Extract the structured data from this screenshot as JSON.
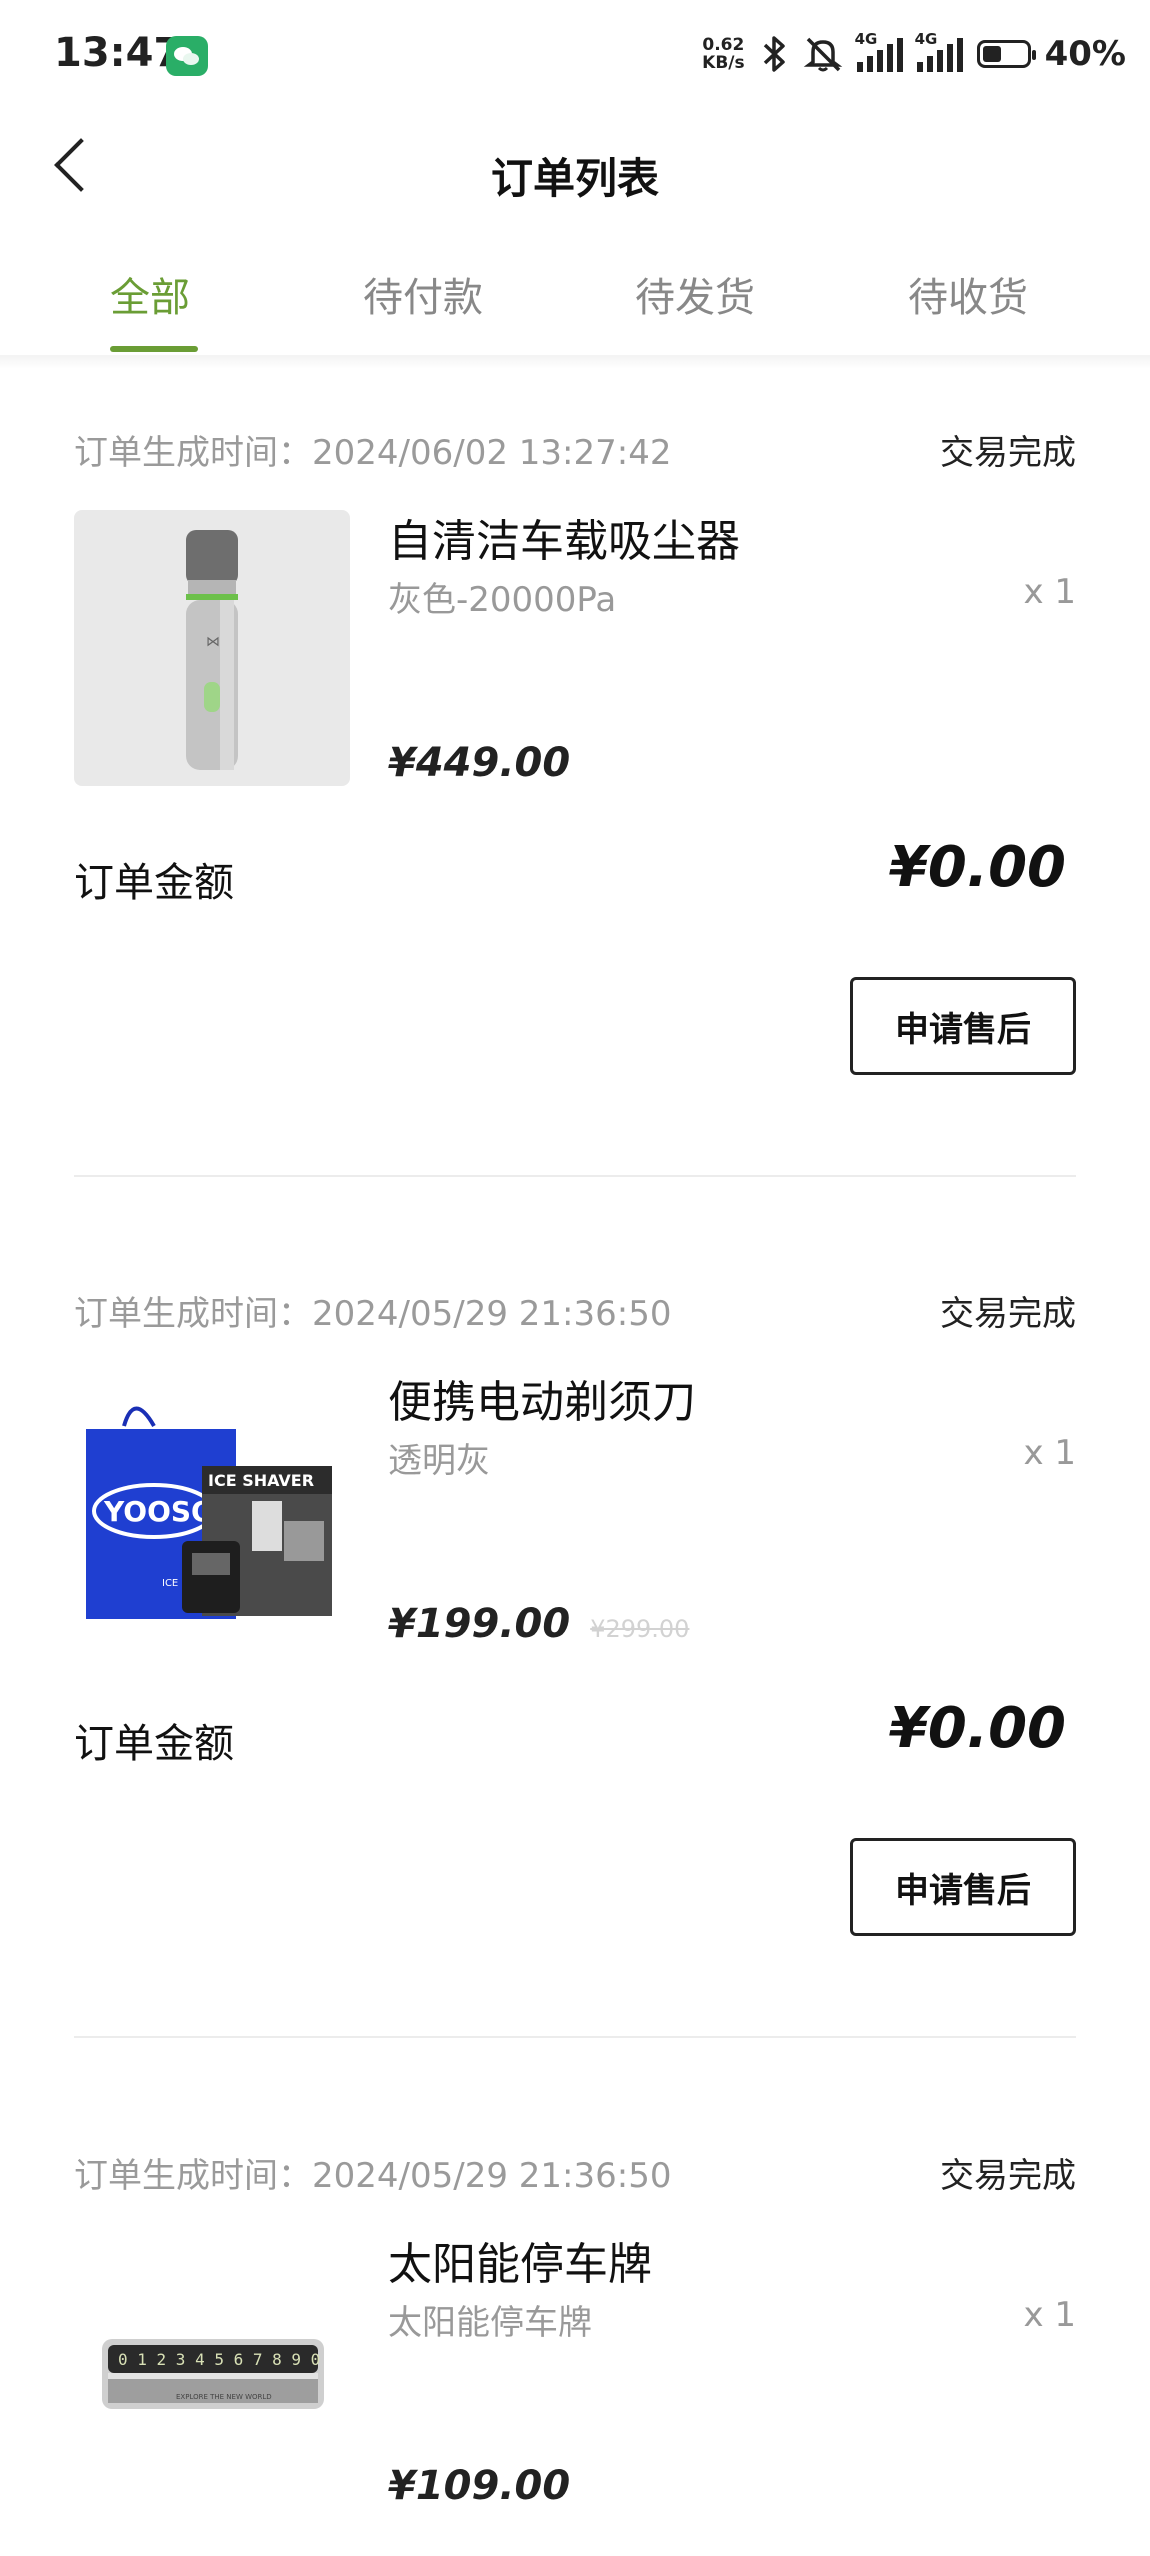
{
  "status_bar": {
    "time": "13:47",
    "net_speed": "0.62",
    "net_unit": "KB/s",
    "signal_tag": "4G",
    "battery": "40%"
  },
  "nav": {
    "title": "订单列表"
  },
  "tabs": [
    "全部",
    "待付款",
    "待发货",
    "待收货"
  ],
  "active_tab": 0,
  "orders": [
    {
      "time": "订单生成时间：2024/06/02 13:27:42",
      "status": "交易完成",
      "product": "自清洁车载吸尘器",
      "spec": "灰色-20000Pa",
      "qty": "x 1",
      "price": "¥449.00",
      "original_price": "",
      "amount_label": "订单金额",
      "amount": "¥0.00",
      "button": "申请售后"
    },
    {
      "time": "订单生成时间：2024/05/29 21:36:50",
      "status": "交易完成",
      "product": "便携电动剃须刀",
      "spec": "透明灰",
      "qty": "x 1",
      "price": "¥199.00",
      "original_price": "¥299.00",
      "amount_label": "订单金额",
      "amount": "¥0.00",
      "button": "申请售后"
    },
    {
      "time": "订单生成时间：2024/05/29 21:36:50",
      "status": "交易完成",
      "product": "太阳能停车牌",
      "spec": "太阳能停车牌",
      "qty": "x 1",
      "price": "¥109.00",
      "original_price": ""
    }
  ],
  "images": {
    "vacuum_logo": "⋈",
    "shaver_bag_text": "YOOSO",
    "shaver_box_text": "ICE SHAVER",
    "shaver_bag_sub": "ICE SHAVER",
    "plate_digits": "0 1 2 3 4 5 6 7 8 9 0",
    "plate_caption": "EXPLORE THE NEW WORLD"
  }
}
